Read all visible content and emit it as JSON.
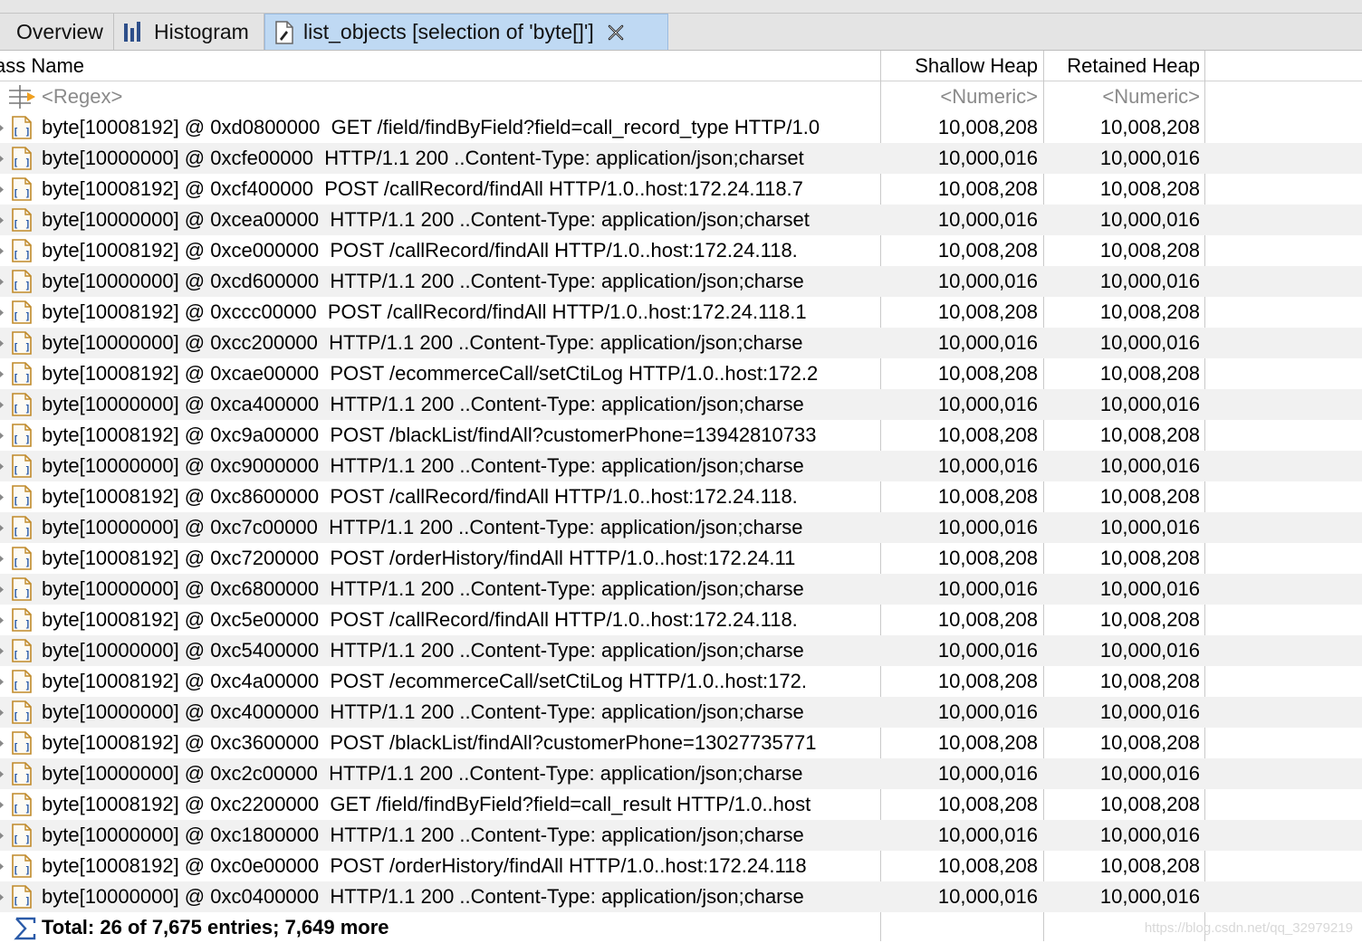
{
  "tabs": [
    {
      "label": "Overview"
    },
    {
      "label": "Histogram"
    },
    {
      "label": "list_objects  [selection of 'byte[]']"
    }
  ],
  "columns": {
    "class_name": "ass Name",
    "shallow": "Shallow Heap",
    "retained": "Retained Heap"
  },
  "filter_row": {
    "name": "<Regex>",
    "shallow": "<Numeric>",
    "retained": "<Numeric>"
  },
  "rows": [
    {
      "name": "byte[10008192] @ 0xd0800000  GET /field/findByField?field=call_record_type HTTP/1.0",
      "shallow": "10,008,208",
      "retained": "10,008,208"
    },
    {
      "name": "byte[10000000] @ 0xcfe00000  HTTP/1.1 200 ..Content-Type: application/json;charset",
      "shallow": "10,000,016",
      "retained": "10,000,016"
    },
    {
      "name": "byte[10008192] @ 0xcf400000  POST /callRecord/findAll HTTP/1.0..host:172.24.118.7",
      "shallow": "10,008,208",
      "retained": "10,008,208"
    },
    {
      "name": "byte[10000000] @ 0xcea00000  HTTP/1.1 200 ..Content-Type: application/json;charset",
      "shallow": "10,000,016",
      "retained": "10,000,016"
    },
    {
      "name": "byte[10008192] @ 0xce000000  POST /callRecord/findAll HTTP/1.0..host:172.24.118.",
      "shallow": "10,008,208",
      "retained": "10,008,208"
    },
    {
      "name": "byte[10000000] @ 0xcd600000  HTTP/1.1 200 ..Content-Type: application/json;charse",
      "shallow": "10,000,016",
      "retained": "10,000,016"
    },
    {
      "name": "byte[10008192] @ 0xccc00000  POST /callRecord/findAll HTTP/1.0..host:172.24.118.1",
      "shallow": "10,008,208",
      "retained": "10,008,208"
    },
    {
      "name": "byte[10000000] @ 0xcc200000  HTTP/1.1 200 ..Content-Type: application/json;charse",
      "shallow": "10,000,016",
      "retained": "10,000,016"
    },
    {
      "name": "byte[10008192] @ 0xcae00000  POST /ecommerceCall/setCtiLog HTTP/1.0..host:172.2",
      "shallow": "10,008,208",
      "retained": "10,008,208"
    },
    {
      "name": "byte[10000000] @ 0xca400000  HTTP/1.1 200 ..Content-Type: application/json;charse",
      "shallow": "10,000,016",
      "retained": "10,000,016"
    },
    {
      "name": "byte[10008192] @ 0xc9a00000  POST /blackList/findAll?customerPhone=13942810733",
      "shallow": "10,008,208",
      "retained": "10,008,208"
    },
    {
      "name": "byte[10000000] @ 0xc9000000  HTTP/1.1 200 ..Content-Type: application/json;charse",
      "shallow": "10,000,016",
      "retained": "10,000,016"
    },
    {
      "name": "byte[10008192] @ 0xc8600000  POST /callRecord/findAll HTTP/1.0..host:172.24.118.",
      "shallow": "10,008,208",
      "retained": "10,008,208"
    },
    {
      "name": "byte[10000000] @ 0xc7c00000  HTTP/1.1 200 ..Content-Type: application/json;charse",
      "shallow": "10,000,016",
      "retained": "10,000,016"
    },
    {
      "name": "byte[10008192] @ 0xc7200000  POST /orderHistory/findAll HTTP/1.0..host:172.24.11",
      "shallow": "10,008,208",
      "retained": "10,008,208"
    },
    {
      "name": "byte[10000000] @ 0xc6800000  HTTP/1.1 200 ..Content-Type: application/json;charse",
      "shallow": "10,000,016",
      "retained": "10,000,016"
    },
    {
      "name": "byte[10008192] @ 0xc5e00000  POST /callRecord/findAll HTTP/1.0..host:172.24.118.",
      "shallow": "10,008,208",
      "retained": "10,008,208"
    },
    {
      "name": "byte[10000000] @ 0xc5400000  HTTP/1.1 200 ..Content-Type: application/json;charse",
      "shallow": "10,000,016",
      "retained": "10,000,016"
    },
    {
      "name": "byte[10008192] @ 0xc4a00000  POST /ecommerceCall/setCtiLog HTTP/1.0..host:172.",
      "shallow": "10,008,208",
      "retained": "10,008,208"
    },
    {
      "name": "byte[10000000] @ 0xc4000000  HTTP/1.1 200 ..Content-Type: application/json;charse",
      "shallow": "10,000,016",
      "retained": "10,000,016"
    },
    {
      "name": "byte[10008192] @ 0xc3600000  POST /blackList/findAll?customerPhone=13027735771",
      "shallow": "10,008,208",
      "retained": "10,008,208"
    },
    {
      "name": "byte[10000000] @ 0xc2c00000  HTTP/1.1 200 ..Content-Type: application/json;charse",
      "shallow": "10,000,016",
      "retained": "10,000,016"
    },
    {
      "name": "byte[10008192] @ 0xc2200000  GET /field/findByField?field=call_result HTTP/1.0..host",
      "shallow": "10,008,208",
      "retained": "10,008,208"
    },
    {
      "name": "byte[10000000] @ 0xc1800000  HTTP/1.1 200 ..Content-Type: application/json;charse",
      "shallow": "10,000,016",
      "retained": "10,000,016"
    },
    {
      "name": "byte[10008192] @ 0xc0e00000  POST /orderHistory/findAll HTTP/1.0..host:172.24.118",
      "shallow": "10,008,208",
      "retained": "10,008,208"
    },
    {
      "name": "byte[10000000] @ 0xc0400000  HTTP/1.1 200 ..Content-Type: application/json;charse",
      "shallow": "10,000,016",
      "retained": "10,000,016"
    }
  ],
  "total": "Total: 26 of 7,675 entries; 7,649 more",
  "watermark": "https://blog.csdn.net/qq_32979219",
  "colors": {
    "active_tab": "#bfd9f3",
    "alt_row": "#f1f1f1",
    "icon_blue": "#2a5aa8"
  }
}
